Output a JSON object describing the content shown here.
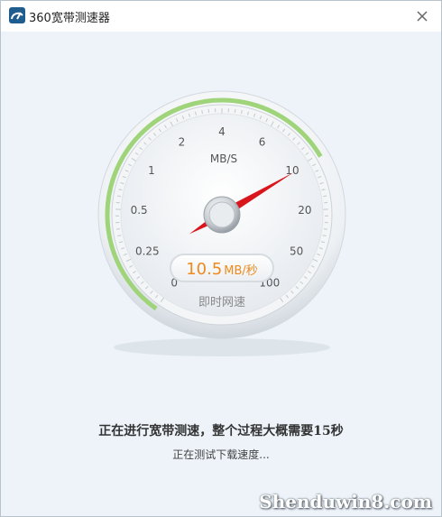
{
  "window": {
    "title": "360宽带测速器",
    "close_symbol": "✕"
  },
  "gauge": {
    "scale_labels": [
      "0",
      "0.25",
      "0.5",
      "1",
      "2",
      "4",
      "6",
      "10",
      "20",
      "50",
      "100"
    ],
    "unit_label": "MB/S",
    "readout_value": "10.5",
    "readout_unit": "MB/秒",
    "caption": "即时网速",
    "current_speed_mbs": 10.5,
    "accent_color": "#ee8a1e",
    "needle_color": "#d9161c",
    "arc_color": "#9fd47a"
  },
  "status": {
    "main": "正在进行宽带测速，整个过程大概需要15秒",
    "sub": "正在测试下载速度..."
  },
  "watermark": "Shenduwin8.com"
}
